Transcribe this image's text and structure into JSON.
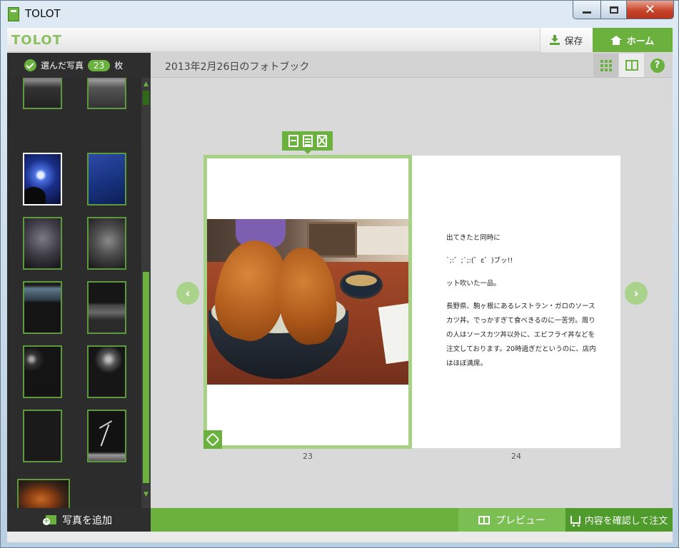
{
  "window": {
    "title": "TOLOT",
    "close_glyph": "✕"
  },
  "header": {
    "logo": "TOLOT",
    "save_label": "保存",
    "home_label": "ホーム"
  },
  "selection": {
    "prefix": "選んだ写真",
    "count": "23",
    "suffix": "枚"
  },
  "book": {
    "title": "2013年2月26日のフォトブック"
  },
  "view_buttons": [
    "grid-view",
    "spread-view",
    "help"
  ],
  "help_label": "?",
  "sidebar": {
    "thumb_count": 13,
    "selected_index": 2
  },
  "nav": {
    "prev": "‹",
    "next": "›"
  },
  "pages": {
    "left_number": "23",
    "right_number": "24",
    "right_text": [
      "出てきたと同時に",
      "`;:゛;`;:(゛ε゛)ブッ!!",
      "ッ卜吹いた一品。",
      "長野県、駒ヶ根にあるレストラン・ガロのソースカツ丼。でっかすぎて食べきるのに一苦労。周りの人はソースカツ丼以外に、エビフライ丼などを注文しております。20時過ぎだというのに、店内はほぼ満席。"
    ]
  },
  "footer": {
    "add_photo": "写真を追加",
    "preview": "プレビュー",
    "order": "内容を確認して注文"
  },
  "colors": {
    "accent": "#6ab23d",
    "accent_light": "#a7d185",
    "sidebar_bg": "#2c2c2c"
  }
}
